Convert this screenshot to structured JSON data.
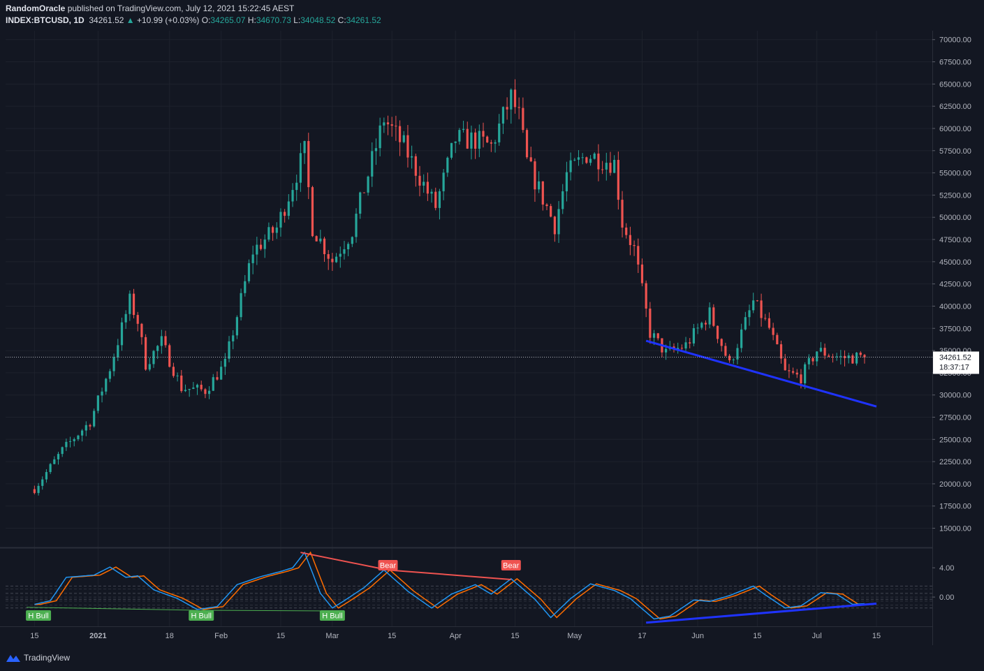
{
  "header": {
    "author": "RandomOracle",
    "published": "published on TradingView.com, July 12, 2021 15:22:45 AEST",
    "symbol": "INDEX:BTCUSD, 1D",
    "last": "34261.52",
    "change": "+10.99 (+0.03%)",
    "o_label": "O:",
    "o_value": "34265.07",
    "h_label": "H:",
    "h_value": "34670.73",
    "l_label": "L:",
    "l_value": "34048.52",
    "c_label": "C:",
    "c_value": "34261.52"
  },
  "footer": {
    "brand": "TradingView"
  },
  "colors": {
    "bg": "#131722",
    "up": "#26a69a",
    "down": "#ef5350",
    "grid": "#1e222d",
    "trend": "#1f33ff"
  },
  "chart_data": {
    "type": "candlestick",
    "y_ticks": [
      "70000.00",
      "67500.00",
      "65000.00",
      "62500.00",
      "60000.00",
      "57500.00",
      "55000.00",
      "52500.00",
      "50000.00",
      "47500.00",
      "45000.00",
      "42500.00",
      "40000.00",
      "37500.00",
      "35000.00",
      "32500.00",
      "30000.00",
      "27500.00",
      "25000.00",
      "22500.00",
      "20000.00",
      "17500.00",
      "15000.00"
    ],
    "ylim": [
      13000,
      71000
    ],
    "x_ticks": [
      "15",
      "2021",
      "18",
      "Feb",
      "15",
      "Mar",
      "15",
      "Apr",
      "15",
      "May",
      "17",
      "Jun",
      "15",
      "Jul",
      "15"
    ],
    "price_label": {
      "value": "34261.52",
      "countdown": "18:37:17"
    },
    "close_anchors": [
      [
        "Dec 15",
        19400
      ],
      [
        "Dec 22",
        23800
      ],
      [
        "Dec 29",
        27000
      ],
      [
        "Jan 3",
        33000
      ],
      [
        "Jan 8",
        40600
      ],
      [
        "Jan 10",
        38300
      ],
      [
        "Jan 12",
        33500
      ],
      [
        "Jan 16",
        36000
      ],
      [
        "Jan 21",
        30800
      ],
      [
        "Jan 27",
        30500
      ],
      [
        "Feb 1",
        33500
      ],
      [
        "Feb 8",
        46200
      ],
      [
        "Feb 14",
        48800
      ],
      [
        "Feb 21",
        57400
      ],
      [
        "Feb 23",
        48900
      ],
      [
        "Feb 28",
        45100
      ],
      [
        "Mar 5",
        48500
      ],
      [
        "Mar 13",
        61100
      ],
      [
        "Mar 18",
        58000
      ],
      [
        "Mar 24",
        52800
      ],
      [
        "Mar 26",
        51200
      ],
      [
        "Mar 31",
        58800
      ],
      [
        "Apr 5",
        58700
      ],
      [
        "Apr 9",
        58000
      ],
      [
        "Apr 14",
        63500
      ],
      [
        "Apr 16",
        61300
      ],
      [
        "Apr 18",
        56200
      ],
      [
        "Apr 25",
        49100
      ],
      [
        "Apr 28",
        54800
      ],
      [
        "May 3",
        57100
      ],
      [
        "May 10",
        56100
      ],
      [
        "May 12",
        49400
      ],
      [
        "May 15",
        46400
      ],
      [
        "May 19",
        37000
      ],
      [
        "May 23",
        34700
      ],
      [
        "May 28",
        35600
      ],
      [
        "Jun 3",
        39200
      ],
      [
        "Jun 8",
        33400
      ],
      [
        "Jun 14",
        40500
      ],
      [
        "Jun 18",
        37500
      ],
      [
        "Jun 22",
        32500
      ],
      [
        "Jun 26",
        32000
      ],
      [
        "Jun 30",
        35000
      ],
      [
        "Jul 6",
        34200
      ],
      [
        "Jul 12",
        34261
      ]
    ],
    "trendlines": [
      {
        "from": [
          "May 18",
          36100
        ],
        "to": [
          "Jul 15",
          28700
        ]
      }
    ],
    "indicator": {
      "type": "stochastic-rsi-divergence",
      "y_ticks": [
        "4.00",
        "0.00"
      ],
      "ylim": [
        -4,
        6.5
      ],
      "levels": [
        1.5,
        0.5,
        -0.3,
        -1.5
      ],
      "k_anchors": [
        [
          "Dec 15",
          -1.0
        ],
        [
          "Dec 19",
          -0.5
        ],
        [
          "Dec 23",
          2.7
        ],
        [
          "Dec 30",
          3.0
        ],
        [
          "Jan 3",
          4.1
        ],
        [
          "Jan 7",
          2.7
        ],
        [
          "Jan 10",
          2.9
        ],
        [
          "Jan 14",
          1.0
        ],
        [
          "Jan 20",
          -0.2
        ],
        [
          "Jan 25",
          -1.7
        ],
        [
          "Jan 30",
          -1.3
        ],
        [
          "Feb 4",
          1.7
        ],
        [
          "Feb 10",
          2.8
        ],
        [
          "Feb 15",
          3.5
        ],
        [
          "Feb 18",
          4.0
        ],
        [
          "Feb 21",
          6.1
        ],
        [
          "Feb 25",
          0.5
        ],
        [
          "Feb 28",
          -1.5
        ],
        [
          "Mar 3",
          -0.5
        ],
        [
          "Mar 8",
          1.3
        ],
        [
          "Mar 13",
          3.7
        ],
        [
          "Mar 19",
          0.8
        ],
        [
          "Mar 25",
          -1.5
        ],
        [
          "Mar 30",
          0.4
        ],
        [
          "Apr 5",
          1.7
        ],
        [
          "Apr 9",
          0.4
        ],
        [
          "Apr 14",
          2.5
        ],
        [
          "Apr 20",
          -0.3
        ],
        [
          "Apr 24",
          -2.8
        ],
        [
          "Apr 29",
          -0.2
        ],
        [
          "May 4",
          1.8
        ],
        [
          "May 10",
          0.9
        ],
        [
          "May 14",
          -0.2
        ],
        [
          "May 20",
          -3.0
        ],
        [
          "May 24",
          -2.6
        ],
        [
          "May 30",
          -0.4
        ],
        [
          "Jun 3",
          -0.6
        ],
        [
          "Jun 8",
          0.2
        ],
        [
          "Jun 14",
          1.5
        ],
        [
          "Jun 17",
          0.3
        ],
        [
          "Jun 22",
          -1.5
        ],
        [
          "Jun 26",
          -1.2
        ],
        [
          "Jul 1",
          0.6
        ],
        [
          "Jul 5",
          0.4
        ],
        [
          "Jul 9",
          -1.0
        ],
        [
          "Jul 12",
          -0.9
        ]
      ],
      "divergence_lines": [
        {
          "from": [
            "Feb 20",
            6.1
          ],
          "to": [
            "Mar 14",
            3.7
          ],
          "color": "#ef5350"
        },
        {
          "from": [
            "Mar 14",
            3.7
          ],
          "to": [
            "Apr 14",
            2.4
          ],
          "color": "#ef5350"
        },
        {
          "from": [
            "Dec 13",
            -1.4
          ],
          "to": [
            "Jan 25",
            -1.8
          ],
          "color": "#4caf50"
        },
        {
          "from": [
            "Jan 26",
            -1.8
          ],
          "to": [
            "Feb 28",
            -1.9
          ],
          "color": "#4caf50"
        },
        {
          "from": [
            "May 18",
            -3.5
          ],
          "to": [
            "Jul 15",
            -0.9
          ],
          "color": "#1f33ff"
        }
      ],
      "labels": [
        {
          "text": "H Bull",
          "kind": "bull",
          "date": "Dec 16"
        },
        {
          "text": "H Bull",
          "kind": "bull",
          "date": "Jan 26"
        },
        {
          "text": "H Bull",
          "kind": "bull",
          "date": "Feb 28"
        },
        {
          "text": "Bear",
          "kind": "bear",
          "date": "Mar 14"
        },
        {
          "text": "Bear",
          "kind": "bear",
          "date": "Apr 14"
        }
      ]
    }
  }
}
